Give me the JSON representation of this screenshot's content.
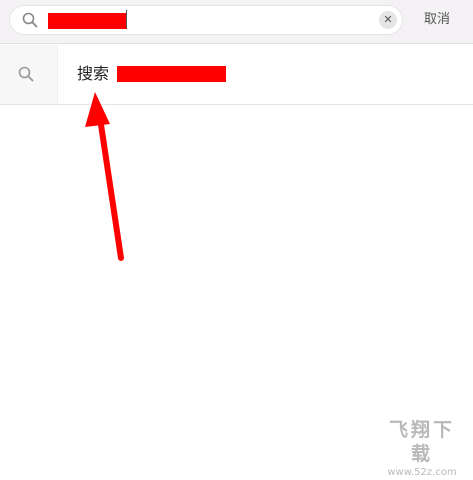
{
  "search_bar": {
    "query_prefix": "",
    "clear_symbol": "✕",
    "cancel_label": "取消"
  },
  "suggestion": {
    "label": "搜索"
  },
  "annotation": {
    "arrow_color": "#ff0000",
    "redaction_color": "#ff0000"
  },
  "watermark": {
    "logo_text": "飞翔下载",
    "url_text": "www.52z.com"
  },
  "icons": {
    "search": "search-icon",
    "clear": "close-icon"
  }
}
